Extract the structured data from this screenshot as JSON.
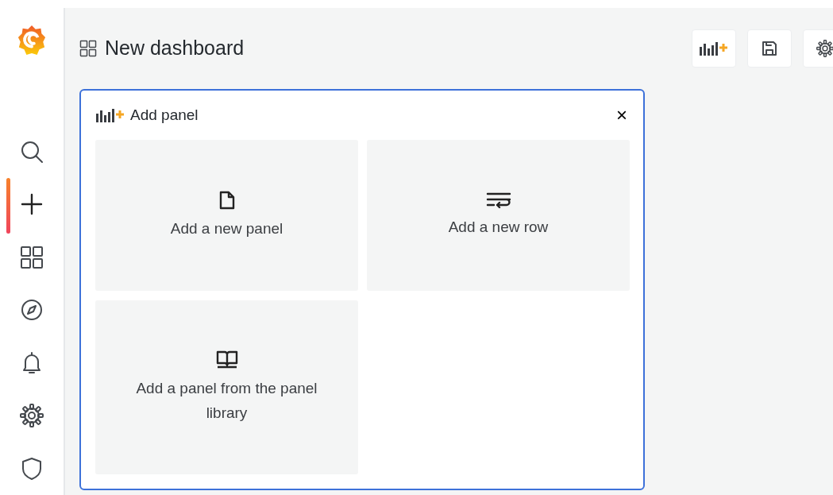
{
  "sidebar": {
    "items": [
      {
        "kind": "search",
        "selected": false
      },
      {
        "kind": "create",
        "selected": true
      },
      {
        "kind": "dashboards",
        "selected": false
      },
      {
        "kind": "explore",
        "selected": false
      },
      {
        "kind": "alerting",
        "selected": false
      },
      {
        "kind": "settings",
        "selected": false
      },
      {
        "kind": "shield",
        "selected": false
      }
    ]
  },
  "header": {
    "title": "New dashboard",
    "buttons": [
      {
        "kind": "add-panel"
      },
      {
        "kind": "save"
      },
      {
        "kind": "settings"
      }
    ]
  },
  "add_panel": {
    "title": "Add panel",
    "close": "×",
    "tiles": [
      {
        "kind": "panel",
        "label": "Add a new panel"
      },
      {
        "kind": "row",
        "label": "Add a new row"
      },
      {
        "kind": "library",
        "label": "Add a panel from the panel library"
      }
    ]
  }
}
